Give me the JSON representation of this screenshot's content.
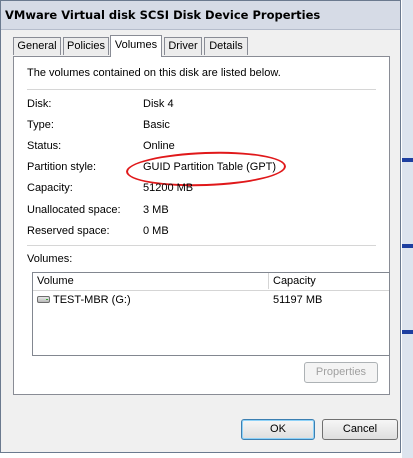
{
  "window": {
    "title": "VMware Virtual disk SCSI Disk Device Properties"
  },
  "tabs": [
    {
      "label": "General"
    },
    {
      "label": "Policies"
    },
    {
      "label": "Volumes"
    },
    {
      "label": "Driver"
    },
    {
      "label": "Details"
    }
  ],
  "active_tab": "Volumes",
  "panel": {
    "intro": "The volumes contained on this disk are listed below.",
    "properties": [
      {
        "label": "Disk:",
        "value": "Disk 4"
      },
      {
        "label": "Type:",
        "value": "Basic"
      },
      {
        "label": "Status:",
        "value": "Online"
      },
      {
        "label": "Partition style:",
        "value": "GUID Partition Table (GPT)"
      },
      {
        "label": "Capacity:",
        "value": "51200 MB"
      },
      {
        "label": "Unallocated space:",
        "value": "3 MB"
      },
      {
        "label": "Reserved space:",
        "value": "0 MB"
      }
    ],
    "annotation_color": "#e0181a",
    "volumes_label": "Volumes:",
    "volumes_table": {
      "columns": [
        "Volume",
        "Capacity"
      ],
      "rows": [
        {
          "icon": "drive-icon",
          "volume": "TEST-MBR (G:)",
          "capacity": "51197 MB"
        }
      ]
    },
    "properties_button": "Properties"
  },
  "footer": {
    "ok": "OK",
    "cancel": "Cancel"
  }
}
